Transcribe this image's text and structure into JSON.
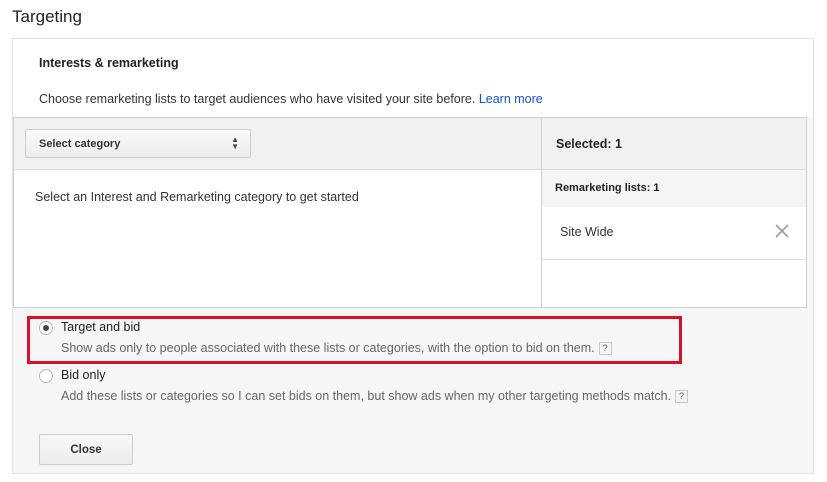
{
  "page": {
    "title": "Targeting"
  },
  "section": {
    "title": "Interests & remarketing",
    "description": "Choose remarketing lists to target audiences who have visited your site before.",
    "learn_more": "Learn more"
  },
  "selector": {
    "category_select": "Select category",
    "empty_message": "Select an Interest and Remarketing category to get started",
    "selected_header": "Selected: 1",
    "group_label": "Remarketing lists: 1",
    "items": [
      {
        "label": "Site Wide"
      }
    ]
  },
  "options": [
    {
      "label": "Target and bid",
      "description": "Show ads only to people associated with these lists or categories, with the option to bid on them.",
      "checked": true
    },
    {
      "label": "Bid only",
      "description": "Add these lists or categories so I can set bids on them, but show ads when my other targeting methods match.",
      "checked": false
    }
  ],
  "help_glyph": "?",
  "buttons": {
    "close": "Close"
  },
  "icons": {
    "select": "updown-icon",
    "remove": "close-icon",
    "help": "help-icon"
  },
  "colors": {
    "link": "#1155cc",
    "highlight": "#d8102a"
  }
}
